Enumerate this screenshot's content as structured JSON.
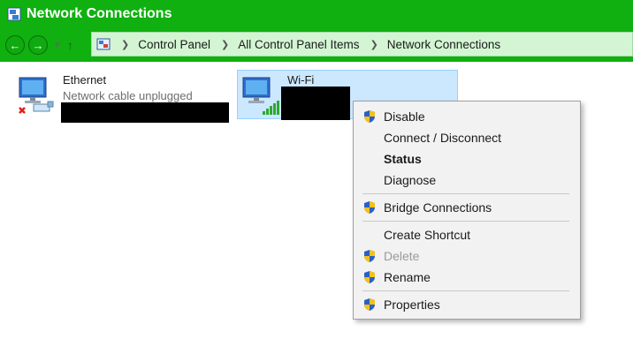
{
  "window": {
    "title": "Network Connections"
  },
  "address": {
    "crumbs": [
      "Control Panel",
      "All Control Panel Items",
      "Network Connections"
    ]
  },
  "connections": [
    {
      "name": "Ethernet",
      "status": "Network cable unplugged"
    },
    {
      "name": "Wi-Fi",
      "status": ""
    }
  ],
  "context_menu": {
    "items": [
      {
        "label": "Disable",
        "shield": true,
        "bold": false,
        "disabled": false
      },
      {
        "label": "Connect / Disconnect",
        "shield": false,
        "bold": false,
        "disabled": false
      },
      {
        "label": "Status",
        "shield": false,
        "bold": true,
        "disabled": false
      },
      {
        "label": "Diagnose",
        "shield": false,
        "bold": false,
        "disabled": false
      },
      {
        "label": "Bridge Connections",
        "shield": true,
        "bold": false,
        "disabled": false
      },
      {
        "label": "Create Shortcut",
        "shield": false,
        "bold": false,
        "disabled": false
      },
      {
        "label": "Delete",
        "shield": true,
        "bold": false,
        "disabled": true
      },
      {
        "label": "Rename",
        "shield": true,
        "bold": false,
        "disabled": false
      },
      {
        "label": "Properties",
        "shield": true,
        "bold": false,
        "disabled": false
      }
    ]
  },
  "colors": {
    "titlebar": "#10b010",
    "addressbar": "#d4f5d4",
    "selection": "#cce8ff",
    "menu_bg": "#f2f2f2"
  }
}
